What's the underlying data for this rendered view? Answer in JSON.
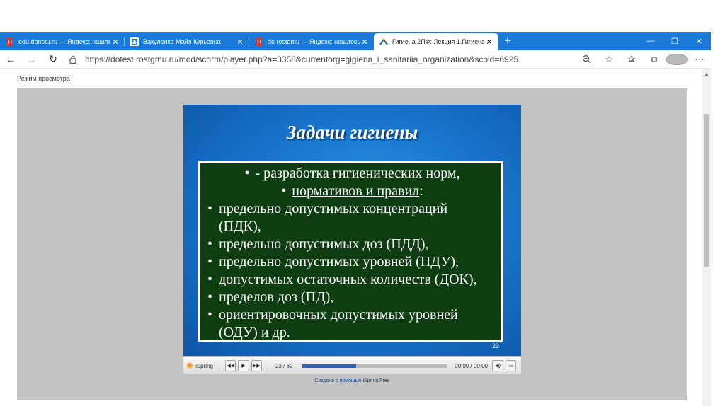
{
  "browser": {
    "tabs": [
      {
        "title": "edu.donstu.ru — Яндекс: нашлось",
        "favicon": "yandex-icon",
        "active": false
      },
      {
        "title": "Вакуленко Майя Юрьевна",
        "favicon": "profile-icon",
        "active": false
      },
      {
        "title": "do rostgmu — Яндекс: нашлось",
        "favicon": "yandex-icon",
        "active": false
      },
      {
        "title": "Гигиена 2ПФ: Лекция 1.Гигиена",
        "favicon": "moodle-icon",
        "active": true
      }
    ],
    "new_tab_label": "+",
    "url": "https://dotest.rostgmu.ru/mod/scorm/player.php?a=3358&currentorg=gigiena_i_sanitariia_organization&scoid=6925",
    "accent_color": "#1c7ad8"
  },
  "page": {
    "mode_label": "Режим просмотра"
  },
  "slide": {
    "title": "Задачи гигиены",
    "intro_line1": "- разработка гигиенических норм,",
    "intro_line2": "нормативов и правил",
    "intro_colon": ":",
    "bullets": [
      {
        "line1": "предельно допустимых концентраций",
        "line2": "(ПДК),"
      },
      {
        "line1": "предельно допустимых доз (ПДД),"
      },
      {
        "line1": "предельно допустимых уровней (ПДУ),"
      },
      {
        "line1": "допустимых остаточных количеств (ДОК),"
      },
      {
        "line1": "пределов доз (ПД),"
      },
      {
        "line1": "ориентировочных допустимых уровней",
        "line2": "(ОДУ) и др."
      }
    ],
    "number": "23",
    "box_color": "#0f3d12"
  },
  "player": {
    "brand": "iSpring",
    "counter": "23 / 62",
    "progress": 0.37,
    "time": "00:00 / 00:00",
    "credit": "Создано с помощью iSpring Free"
  }
}
